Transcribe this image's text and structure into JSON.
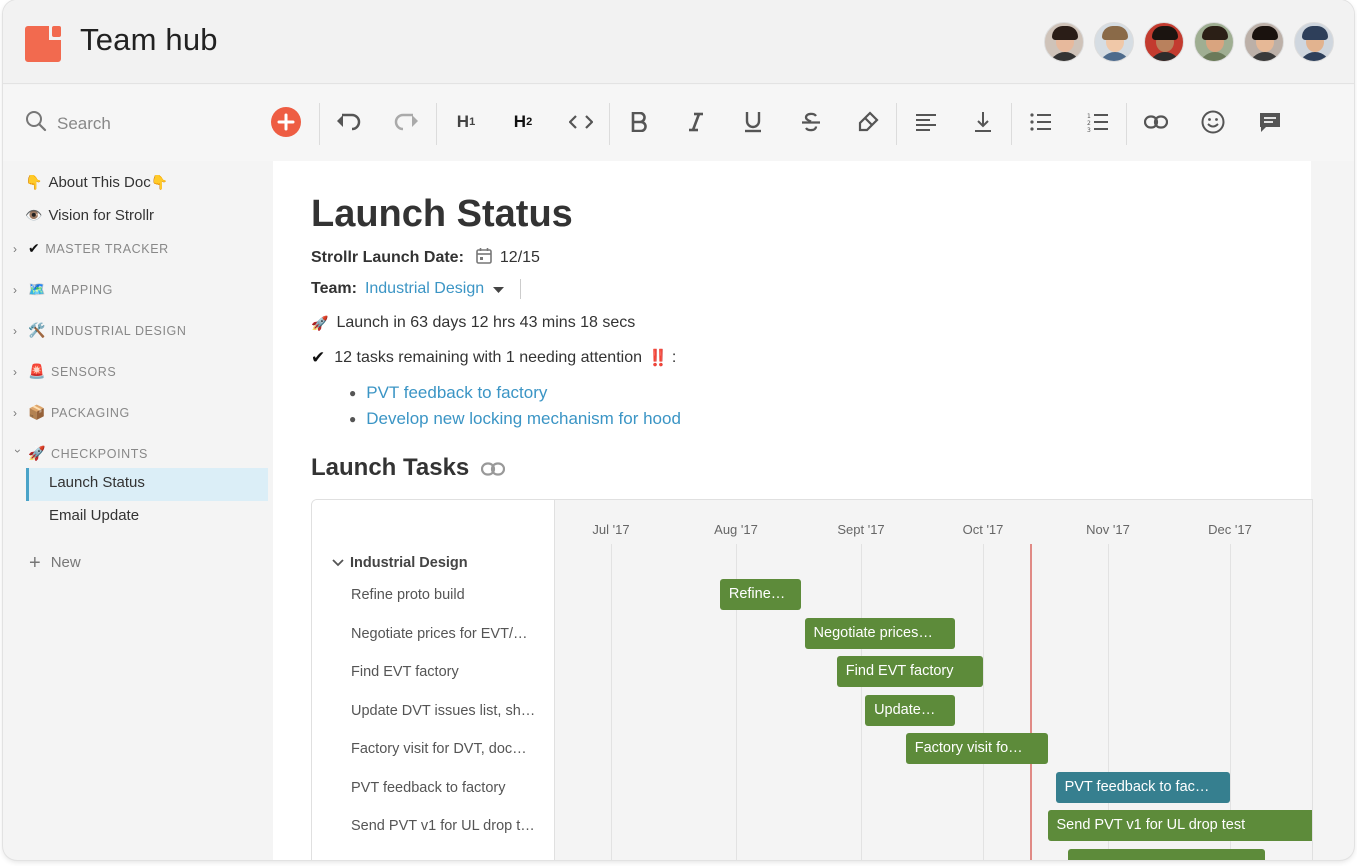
{
  "app": {
    "title": "Team hub",
    "brand_color": "#f26a4f",
    "avatars": [
      {
        "name": "avatar-1",
        "hair": "#2a1d17",
        "face": "#e7b99c",
        "bg": "#cfc3b9",
        "body": "#333"
      },
      {
        "name": "avatar-2",
        "hair": "#8a6a48",
        "face": "#f0c8a8",
        "bg": "#d6dde3",
        "body": "#4e6b8c"
      },
      {
        "name": "avatar-3",
        "hair": "#1b1410",
        "face": "#b9815d",
        "bg": "#c33b2f",
        "body": "#2c2c2c"
      },
      {
        "name": "avatar-4",
        "hair": "#2b1f16",
        "face": "#d9a47f",
        "bg": "#9fae92",
        "body": "#6b7a5a"
      },
      {
        "name": "avatar-5",
        "hair": "#1a120e",
        "face": "#e6b896",
        "bg": "#bcb0a8",
        "body": "#3a3a3a"
      },
      {
        "name": "avatar-6",
        "hair": "#2e3f5a",
        "face": "#e2b38f",
        "bg": "#cfd6de",
        "body": "#2e3f5a"
      }
    ]
  },
  "toolbar": {
    "search_label": "Search",
    "h1_label": "H",
    "h1_sub": "1",
    "h2_label": "H",
    "h2_sub": "2",
    "add_color": "#ee5d43"
  },
  "sidebar": {
    "pages": [
      {
        "icon": "👇",
        "label": "About This Doc",
        "suffix": "👇"
      },
      {
        "icon": "👁️",
        "label": "Vision for Strollr"
      }
    ],
    "sections": [
      {
        "icon": "✔",
        "label": "MASTER TRACKER",
        "expanded": false
      },
      {
        "icon": "🗺️",
        "label": "MAPPING",
        "expanded": false
      },
      {
        "icon": "🛠️",
        "label": "INDUSTRIAL DESIGN",
        "expanded": false
      },
      {
        "icon": "🚨",
        "label": "SENSORS",
        "expanded": false
      },
      {
        "icon": "📦",
        "label": "PACKAGING",
        "expanded": false
      },
      {
        "icon": "🚀",
        "label": "CHECKPOINTS",
        "expanded": true
      }
    ],
    "checkpoint_pages": [
      "Launch Status",
      "Email Update"
    ],
    "active_page": "Launch Status",
    "new_label": "New"
  },
  "doc": {
    "title": "Launch Status",
    "launch_date_label": "Strollr Launch Date:",
    "launch_date_value": "12/15",
    "team_label": "Team:",
    "team_value": "Industrial Design",
    "countdown_icon": "🚀",
    "countdown_text": "Launch in 63 days 12 hrs 43 mins 18 secs",
    "tasks_icon": "✔",
    "tasks_text": "12 tasks remaining with 1 needing attention",
    "tasks_alert": "‼️",
    "tasks_suffix": ":",
    "task_links": [
      "PVT feedback to factory",
      "Develop new locking mechanism for hood"
    ],
    "section_title": "Launch Tasks"
  },
  "gantt": {
    "months": [
      "Jul '17",
      "Aug '17",
      "Sept '17",
      "Oct '17",
      "Nov '17",
      "Dec '17"
    ],
    "group": "Industrial Design",
    "today_marker_color": "#e08a85",
    "bar_color": "#5d8b3a",
    "highlight_color": "#367f8f",
    "tasks": [
      {
        "name": "Refine proto build",
        "bar_label": "Refine…",
        "start": "2017-07-28",
        "end": "2017-08-17"
      },
      {
        "name": "Negotiate prices for EVT/…",
        "bar_label": "Negotiate prices…",
        "start": "2017-08-18",
        "end": "2017-09-24"
      },
      {
        "name": "Find EVT factory",
        "bar_label": "Find EVT factory",
        "start": "2017-08-26",
        "end": "2017-10-01"
      },
      {
        "name": "Update DVT issues list, sh…",
        "bar_label": "Update…",
        "start": "2017-09-02",
        "end": "2017-09-24"
      },
      {
        "name": "Factory visit for DVT, doc…",
        "bar_label": "Factory visit fo…",
        "start": "2017-09-12",
        "end": "2017-10-17"
      },
      {
        "name": "PVT feedback to factory",
        "bar_label": "PVT feedback to fac…",
        "start": "2017-10-19",
        "end": "2017-12-01",
        "highlight": true
      },
      {
        "name": "Send PVT v1 for UL drop t…",
        "bar_label": "Send PVT v1 for UL drop test",
        "start": "2017-10-17",
        "end": "2017-12-24"
      },
      {
        "name": "",
        "bar_label": "",
        "start": "2017-10-22",
        "end": "2017-12-10"
      }
    ]
  }
}
